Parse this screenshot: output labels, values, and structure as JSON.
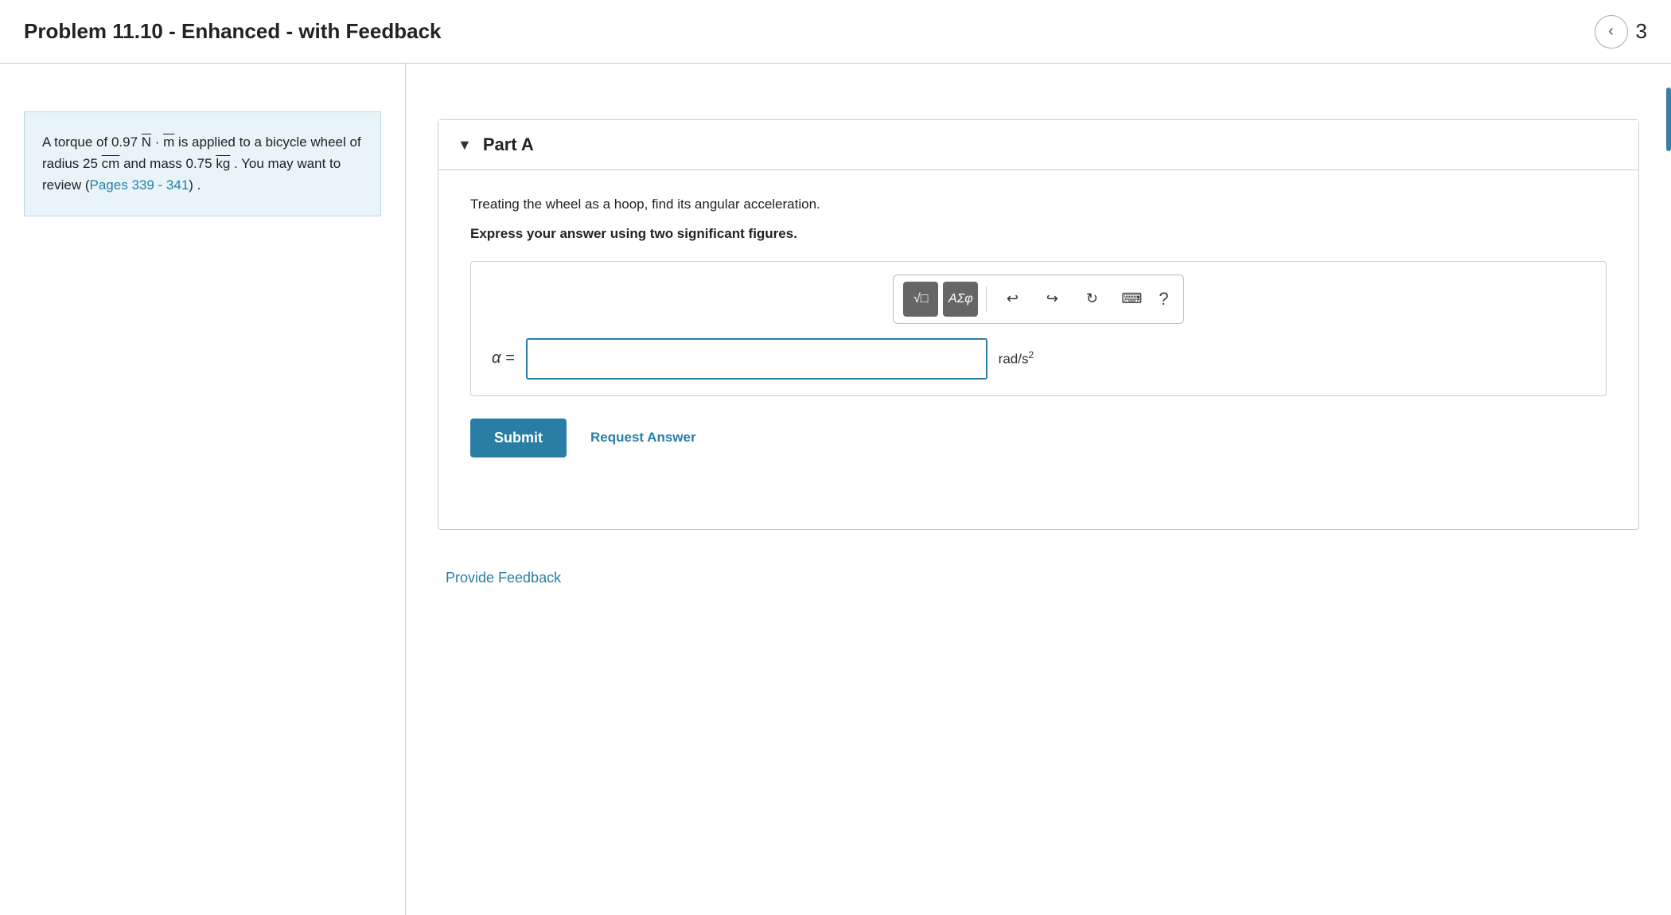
{
  "header": {
    "title": "Problem 11.10 - Enhanced - with Feedback",
    "nav_back_label": "‹",
    "nav_number": "3"
  },
  "left_panel": {
    "problem_text_1": "A torque of 0.97 N · m is applied to a bicycle wheel of radius 25 cm and mass 0.75 kg . You may want to review (",
    "problem_link_text": "Pages 339 - 341",
    "problem_text_2": ") ."
  },
  "right_panel": {
    "part_a": {
      "label": "Part A",
      "question": "Treating the wheel as a hoop, find its angular acceleration.",
      "instruction": "Express your answer using two significant figures.",
      "alpha_label": "α =",
      "unit": "rad/s²",
      "input_placeholder": "",
      "toolbar": {
        "sqrt_label": "√",
        "sigma_label": "ΑΣφ",
        "undo_label": "↩",
        "redo_label": "↪",
        "refresh_label": "↻",
        "keyboard_label": "⌨",
        "help_label": "?"
      },
      "submit_label": "Submit",
      "request_answer_label": "Request Answer"
    },
    "provide_feedback_label": "Provide Feedback"
  }
}
